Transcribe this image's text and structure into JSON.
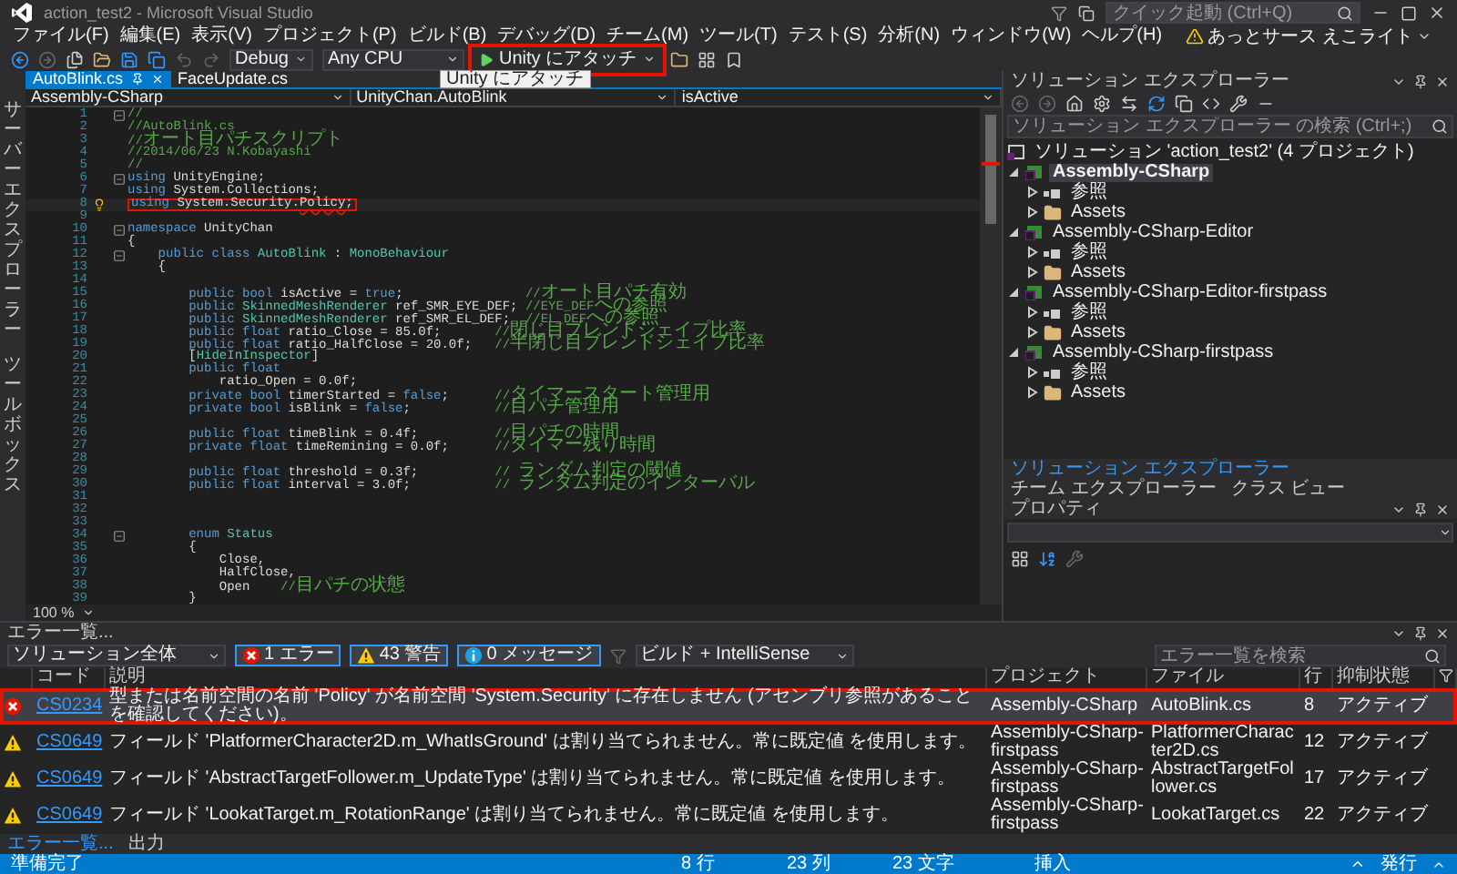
{
  "window": {
    "title": "action_test2 - Microsoft Visual Studio",
    "quick_launch": {
      "placeholder": "クイック起動 (Ctrl+Q)"
    }
  },
  "menu": [
    "ファイル(F)",
    "編集(E)",
    "表示(V)",
    "プロジェクト(P)",
    "ビルド(B)",
    "デバッグ(D)",
    "チーム(M)",
    "ツール(T)",
    "テスト(S)",
    "分析(N)",
    "ウィンドウ(W)",
    "ヘルプ(H)"
  ],
  "account": {
    "name": "あっとサース えこライト"
  },
  "toolbar": {
    "configuration": "Debug",
    "platform": "Any CPU",
    "attach": {
      "label": "Unity にアタッチ",
      "highlighted": true
    },
    "tooltip": "Unity にアタッチ"
  },
  "side_strip": [
    "サーバーエクスプローラー",
    "ツールボックス"
  ],
  "doc_tabs": [
    {
      "label": "AutoBlink.cs",
      "selected": true
    },
    {
      "label": "FaceUpdate.cs",
      "selected": false
    }
  ],
  "nav": [
    "Assembly-CSharp",
    "UnityChan.AutoBlink",
    "isActive"
  ],
  "code_lines": [
    {
      "n": "1",
      "fold": true,
      "s": [
        {
          "kind": "comment",
          "t": "//"
        }
      ]
    },
    {
      "n": "2",
      "fold": false,
      "s": [
        {
          "kind": "comment",
          "t": "//AutoBlink.cs"
        }
      ]
    },
    {
      "n": "3",
      "fold": false,
      "s": [
        {
          "kind": "comment",
          "t": "//オート目パチスクリプト"
        }
      ]
    },
    {
      "n": "4",
      "fold": false,
      "s": [
        {
          "kind": "comment",
          "t": "//2014/06/23 N.Kobayashi"
        }
      ]
    },
    {
      "n": "5",
      "fold": false,
      "s": [
        {
          "kind": "comment",
          "t": "//"
        }
      ]
    },
    {
      "n": "6",
      "fold": true,
      "s": [
        {
          "kind": "keyword",
          "t": "using"
        },
        {
          "kind": "plain",
          "t": " UnityEngine;"
        }
      ]
    },
    {
      "n": "7",
      "fold": false,
      "s": [
        {
          "kind": "keyword",
          "t": "using"
        },
        {
          "kind": "plain",
          "t": " System.Collections;"
        }
      ]
    },
    {
      "n": "8",
      "fold": false,
      "current": true,
      "lightbulb": true,
      "highlighted": true,
      "s": [
        {
          "kind": "keyword",
          "t": "using"
        },
        {
          "kind": "plain",
          "t": " System.Security."
        },
        {
          "kind": "error",
          "t": "Policy"
        },
        {
          "kind": "plain",
          "t": ";"
        }
      ]
    },
    {
      "n": "9",
      "fold": false
    },
    {
      "n": "10",
      "fold": true,
      "s": [
        {
          "kind": "keyword",
          "t": "namespace"
        },
        {
          "kind": "plain",
          "t": " UnityChan"
        }
      ]
    },
    {
      "n": "11",
      "fold": false,
      "s": [
        {
          "kind": "plain",
          "t": "{"
        }
      ]
    },
    {
      "n": "12",
      "fold": true,
      "s": [
        {
          "kind": "keyword",
          "t": "    public class"
        },
        {
          "kind": "type",
          "t": " AutoBlink"
        },
        {
          "kind": "plain",
          "t": " : "
        },
        {
          "kind": "type",
          "t": "MonoBehaviour"
        }
      ]
    },
    {
      "n": "13",
      "fold": false,
      "s": [
        {
          "kind": "plain",
          "t": "    {"
        }
      ]
    },
    {
      "n": "14",
      "fold": false
    },
    {
      "n": "15",
      "fold": false,
      "s": [
        {
          "kind": "keyword",
          "t": "        public bool"
        },
        {
          "kind": "plain",
          "t": " isActive = "
        },
        {
          "kind": "keyword",
          "t": "true"
        },
        {
          "kind": "plain",
          "t": ";                "
        },
        {
          "kind": "comment",
          "t": "//オート目パチ有効"
        }
      ]
    },
    {
      "n": "16",
      "fold": false,
      "s": [
        {
          "kind": "keyword",
          "t": "        public"
        },
        {
          "kind": "type",
          "t": " SkinnedMeshRenderer"
        },
        {
          "kind": "plain",
          "t": " ref_SMR_EYE_DEF; "
        },
        {
          "kind": "comment",
          "t": "//EYE_DEFへの参照"
        }
      ]
    },
    {
      "n": "17",
      "fold": false,
      "s": [
        {
          "kind": "keyword",
          "t": "        public"
        },
        {
          "kind": "type",
          "t": " SkinnedMeshRenderer"
        },
        {
          "kind": "plain",
          "t": " ref_SMR_EL_DEF;  "
        },
        {
          "kind": "comment",
          "t": "//EL_DEFへの参照"
        }
      ]
    },
    {
      "n": "18",
      "fold": false,
      "s": [
        {
          "kind": "keyword",
          "t": "        public float"
        },
        {
          "kind": "plain",
          "t": " ratio_Close = 85.0f;       "
        },
        {
          "kind": "comment",
          "t": "//閉じ目ブレンドシェイプ比率"
        }
      ]
    },
    {
      "n": "19",
      "fold": false,
      "s": [
        {
          "kind": "keyword",
          "t": "        public float"
        },
        {
          "kind": "plain",
          "t": " ratio_HalfClose = 20.0f;   "
        },
        {
          "kind": "comment",
          "t": "//半閉じ目ブレンドシェイプ比率"
        }
      ]
    },
    {
      "n": "20",
      "fold": false,
      "s": [
        {
          "kind": "plain",
          "t": "        ["
        },
        {
          "kind": "type",
          "t": "HideInInspector"
        },
        {
          "kind": "plain",
          "t": "]"
        }
      ]
    },
    {
      "n": "21",
      "fold": false,
      "s": [
        {
          "kind": "keyword",
          "t": "        public float"
        }
      ]
    },
    {
      "n": "22",
      "fold": false,
      "s": [
        {
          "kind": "plain",
          "t": "            ratio_Open = 0.0f;"
        }
      ]
    },
    {
      "n": "23",
      "fold": false,
      "s": [
        {
          "kind": "keyword",
          "t": "        private bool"
        },
        {
          "kind": "plain",
          "t": " timerStarted = "
        },
        {
          "kind": "keyword",
          "t": "false"
        },
        {
          "kind": "plain",
          "t": ";      "
        },
        {
          "kind": "comment",
          "t": "//タイマースタート管理用"
        }
      ]
    },
    {
      "n": "24",
      "fold": false,
      "s": [
        {
          "kind": "keyword",
          "t": "        private bool"
        },
        {
          "kind": "plain",
          "t": " isBlink = "
        },
        {
          "kind": "keyword",
          "t": "false"
        },
        {
          "kind": "plain",
          "t": ";           "
        },
        {
          "kind": "comment",
          "t": "//目パチ管理用"
        }
      ]
    },
    {
      "n": "25",
      "fold": false
    },
    {
      "n": "26",
      "fold": false,
      "s": [
        {
          "kind": "keyword",
          "t": "        public float"
        },
        {
          "kind": "plain",
          "t": " timeBlink = 0.4f;          "
        },
        {
          "kind": "comment",
          "t": "//目パチの時間"
        }
      ]
    },
    {
      "n": "27",
      "fold": false,
      "s": [
        {
          "kind": "keyword",
          "t": "        private float"
        },
        {
          "kind": "plain",
          "t": " timeRemining = 0.0f;      "
        },
        {
          "kind": "comment",
          "t": "//タイマー残り時間"
        }
      ]
    },
    {
      "n": "28",
      "fold": false
    },
    {
      "n": "29",
      "fold": false,
      "s": [
        {
          "kind": "keyword",
          "t": "        public float"
        },
        {
          "kind": "plain",
          "t": " threshold = 0.3f;          "
        },
        {
          "kind": "comment",
          "t": "// ランダム判定の閾値"
        }
      ]
    },
    {
      "n": "30",
      "fold": false,
      "s": [
        {
          "kind": "keyword",
          "t": "        public float"
        },
        {
          "kind": "plain",
          "t": " interval = 3.0f;           "
        },
        {
          "kind": "comment",
          "t": "// ランダム判定のインターバル"
        }
      ]
    },
    {
      "n": "31",
      "fold": false
    },
    {
      "n": "32",
      "fold": false
    },
    {
      "n": "33",
      "fold": false
    },
    {
      "n": "34",
      "fold": true,
      "s": [
        {
          "kind": "keyword",
          "t": "        enum"
        },
        {
          "kind": "type",
          "t": " Status"
        }
      ]
    },
    {
      "n": "35",
      "fold": false,
      "s": [
        {
          "kind": "plain",
          "t": "        {"
        }
      ]
    },
    {
      "n": "36",
      "fold": false,
      "s": [
        {
          "kind": "plain",
          "t": "            Close,"
        }
      ]
    },
    {
      "n": "37",
      "fold": false,
      "s": [
        {
          "kind": "plain",
          "t": "            HalfClose,"
        }
      ]
    },
    {
      "n": "38",
      "fold": false,
      "s": [
        {
          "kind": "plain",
          "t": "            Open    "
        },
        {
          "kind": "comment",
          "t": "//目パチの状態"
        }
      ]
    },
    {
      "n": "39",
      "fold": false,
      "s": [
        {
          "kind": "plain",
          "t": "        }"
        }
      ]
    }
  ],
  "zoom": "100 %",
  "solution_explorer": {
    "title": "ソリューション エクスプローラー",
    "search": {
      "placeholder": "ソリューション エクスプローラー の検索 (Ctrl+;)"
    },
    "solution": "ソリューション 'action_test2' (4 プロジェクト)",
    "projects": [
      {
        "name": "Assembly-CSharp",
        "selected": true,
        "expanded": true,
        "children": [
          {
            "kind": "references",
            "label": "参照",
            "expanded": false
          },
          {
            "kind": "folder",
            "label": "Assets",
            "expanded": false
          }
        ]
      },
      {
        "name": "Assembly-CSharp-Editor",
        "selected": false,
        "expanded": true,
        "children": [
          {
            "kind": "references",
            "label": "参照",
            "expanded": false
          },
          {
            "kind": "folder",
            "label": "Assets",
            "expanded": false
          }
        ]
      },
      {
        "name": "Assembly-CSharp-Editor-firstpass",
        "selected": false,
        "expanded": true,
        "children": [
          {
            "kind": "references",
            "label": "参照",
            "expanded": false
          },
          {
            "kind": "folder",
            "label": "Assets",
            "expanded": false
          }
        ]
      },
      {
        "name": "Assembly-CSharp-firstpass",
        "selected": false,
        "expanded": true,
        "children": [
          {
            "kind": "references",
            "label": "参照",
            "expanded": false
          },
          {
            "kind": "folder",
            "label": "Assets",
            "expanded": false
          }
        ]
      }
    ],
    "tabs": [
      {
        "label": "ソリューション エクスプローラー",
        "selected": true
      },
      {
        "label": "チーム エクスプローラー",
        "selected": false
      },
      {
        "label": "クラス ビュー",
        "selected": false
      }
    ]
  },
  "properties": {
    "title": "プロパティ"
  },
  "error_list": {
    "title": "エラー一覧...",
    "scope": "ソリューション全体",
    "filters": [
      {
        "kind": "error",
        "label": "1 エラー",
        "selected": true
      },
      {
        "kind": "warning",
        "label": "43 警告",
        "selected": true
      },
      {
        "kind": "message",
        "label": "0 メッセージ",
        "selected": true
      }
    ],
    "source": "ビルド + IntelliSense",
    "search": {
      "placeholder": "エラー一覧を検索"
    },
    "columns": [
      "コード",
      "説明",
      "プロジェクト",
      "ファイル",
      "行",
      "抑制状態"
    ],
    "rows": [
      {
        "kind": "error",
        "selected": true,
        "highlighted": true,
        "code": "CS0234",
        "description": "型または名前空間の名前 'Policy' が名前空間 'System.Security' に存在しません (アセンブリ参照があることを確認してください)。",
        "project": "Assembly-CSharp",
        "file": "AutoBlink.cs",
        "line": "8",
        "state": "アクティブ"
      },
      {
        "kind": "warning",
        "selected": false,
        "highlighted": false,
        "code": "CS0649",
        "description": "フィールド 'PlatformerCharacter2D.m_WhatIsGround' は割り当てられません。常に既定値 を使用します。",
        "project": "Assembly-CSharp-firstpass",
        "file": "PlatformerCharacter2D.cs",
        "line": "12",
        "state": "アクティブ"
      },
      {
        "kind": "warning",
        "selected": false,
        "highlighted": false,
        "code": "CS0649",
        "description": "フィールド 'AbstractTargetFollower.m_UpdateType' は割り当てられません。常に既定値 を使用します。",
        "project": "Assembly-CSharp-firstpass",
        "file": "AbstractTargetFollower.cs",
        "line": "17",
        "state": "アクティブ"
      },
      {
        "kind": "warning",
        "selected": false,
        "highlighted": false,
        "code": "CS0649",
        "description": "フィールド 'LookatTarget.m_RotationRange' は割り当てられません。常に既定値 を使用します。",
        "project": "Assembly-CSharp-firstpass",
        "file": "LookatTarget.cs",
        "line": "22",
        "state": "アクティブ"
      }
    ],
    "tabs": [
      {
        "label": "エラー一覧...",
        "selected": true
      },
      {
        "label": "出力",
        "selected": false
      }
    ]
  },
  "status_bar": {
    "message": "準備完了",
    "line": "8 行",
    "column": "23 列",
    "chars": "23 文字",
    "mode": "挿入",
    "publish": "発行"
  }
}
